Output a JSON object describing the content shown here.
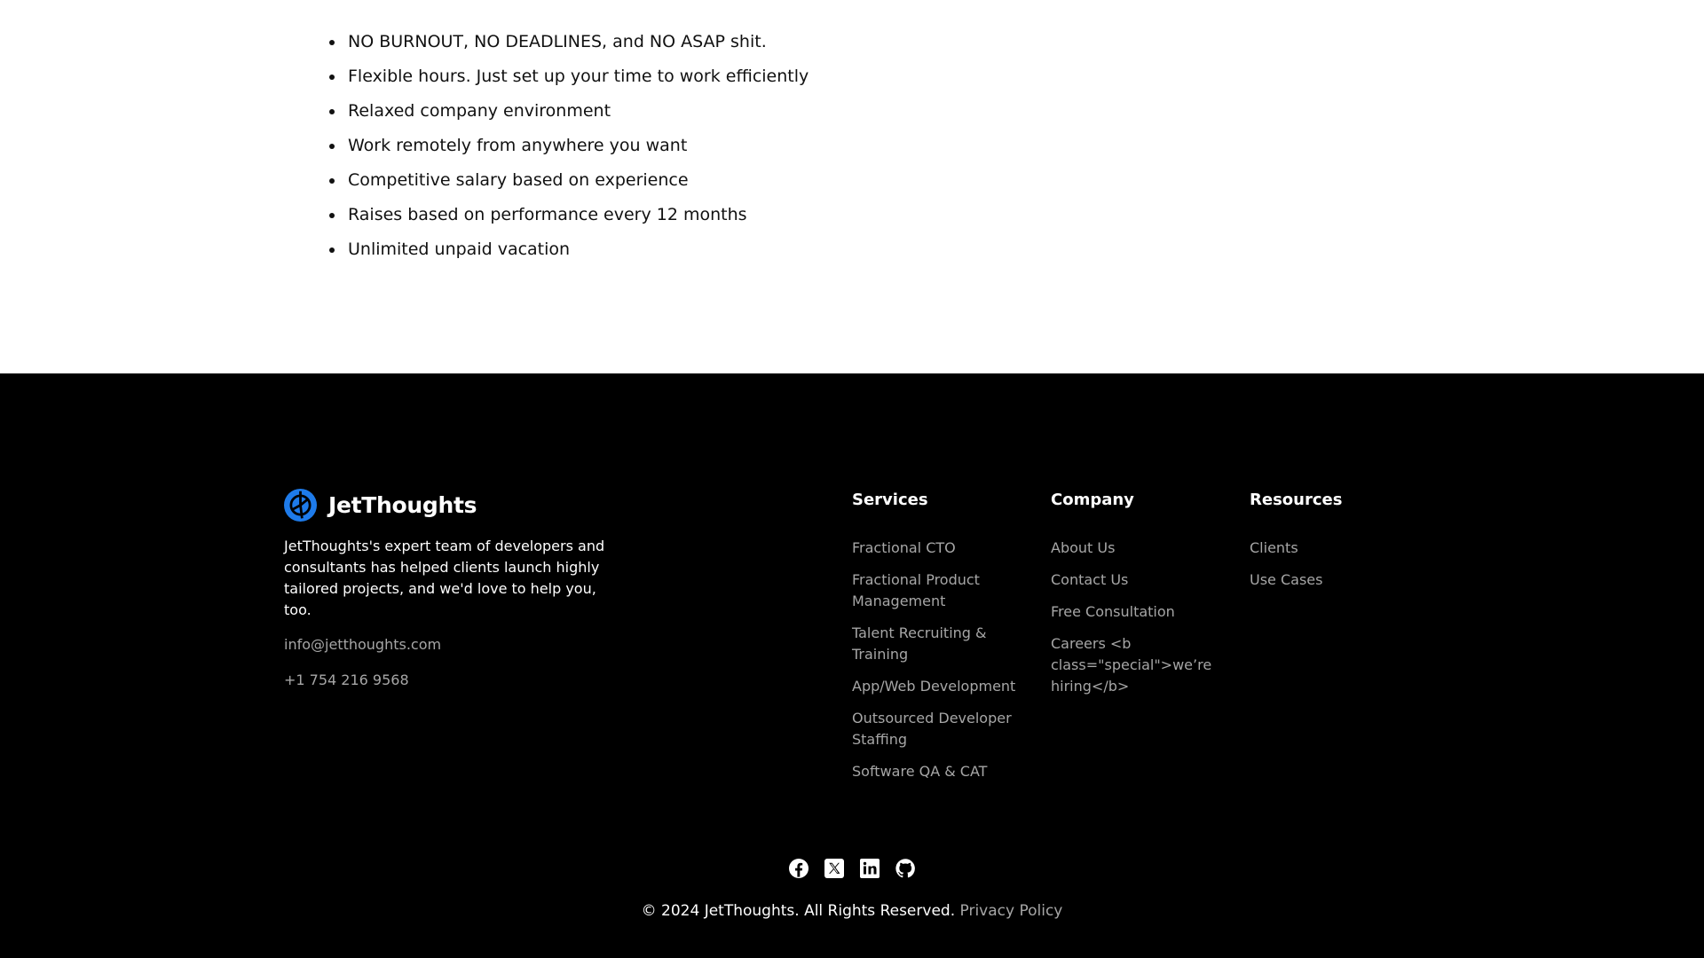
{
  "benefits": [
    "NO BURNOUT, NO DEADLINES, and NO ASAP shit.",
    "Flexible hours. Just set up your time to work efficiently",
    "Relaxed company environment",
    "Work remotely from anywhere you want",
    "Competitive salary based on experience",
    "Raises based on performance every 12 months",
    "Unlimited unpaid vacation"
  ],
  "footer": {
    "brand_name": "JetThoughts",
    "logo_icon": "jetthoughts-logo-icon",
    "description": "JetThoughts's expert team of developers and consultants has helped clients launch highly tailored projects, and we'd love to help you, too.",
    "email": "info@jetthoughts.com",
    "phone": "+1 754 216 9568",
    "columns": {
      "services": {
        "title": "Services",
        "items": [
          "Fractional CTO",
          "Fractional Product Management",
          "Talent Recruiting & Training",
          "App/Web Development",
          "Outsourced Developer Staffing",
          "Software QA & CAT"
        ]
      },
      "company": {
        "title": "Company",
        "items": [
          "About Us",
          "Contact Us",
          "Free Consultation",
          "Careers <b class=\"special\">we’re hiring</b>"
        ]
      },
      "resources": {
        "title": "Resources",
        "items": [
          "Clients",
          "Use Cases"
        ]
      }
    },
    "social_icons": [
      "facebook-icon",
      "x-twitter-icon",
      "linkedin-icon",
      "github-icon"
    ],
    "copyright": "© 2024 JetThoughts. All Rights Reserved.",
    "privacy_label": "Privacy Policy",
    "colors": {
      "background": "#000000",
      "accent": "#1e7bea",
      "muted_link": "#a6a6a6"
    }
  }
}
